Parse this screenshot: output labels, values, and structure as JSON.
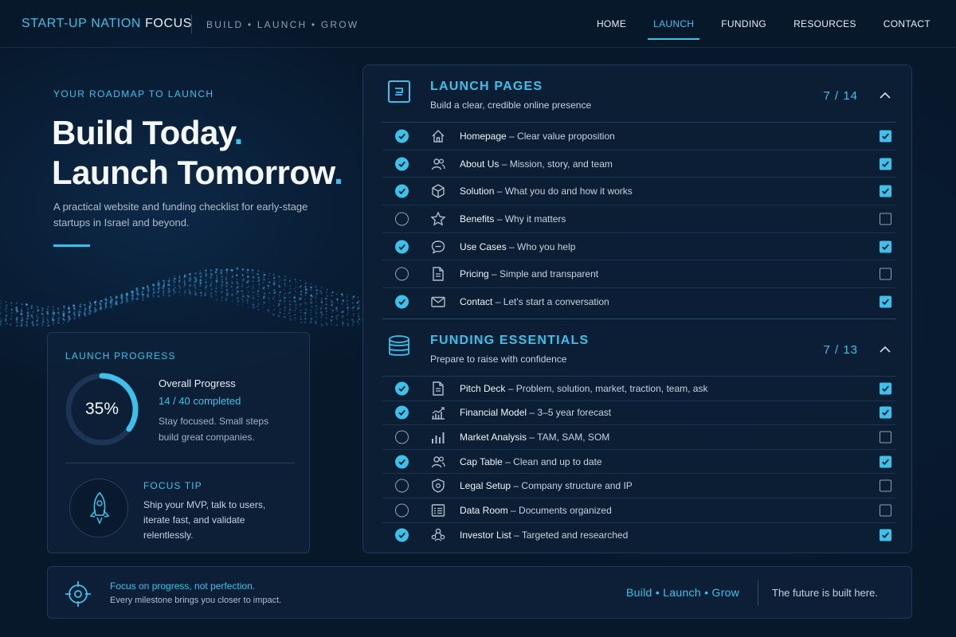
{
  "header": {
    "brand_accent": "START-UP NATION",
    "brand_focus": "FOCUS",
    "tagline": "BUILD • LAUNCH • GROW",
    "nav": [
      {
        "label": "HOME",
        "active": false
      },
      {
        "label": "LAUNCH",
        "active": true
      },
      {
        "label": "FUNDING",
        "active": false
      },
      {
        "label": "RESOURCES",
        "active": false
      },
      {
        "label": "CONTACT",
        "active": false
      }
    ]
  },
  "hero": {
    "eyebrow": "YOUR ROADMAP TO LAUNCH",
    "title_line1": "Build Today",
    "title_line2": "Launch Tomorrow",
    "title_dot": ".",
    "description": "A practical website and funding checklist for early-stage startups in Israel and beyond."
  },
  "progress_card": {
    "label": "LAUNCH PROGRESS",
    "percent_text": "35%",
    "percent_value": 35,
    "title": "Overall Progress",
    "count": "14 / 40 completed",
    "description": "Stay focused. Small steps build great companies.",
    "tip_title": "FOCUS TIP",
    "tip_text": "Ship your MVP, talk to users, iterate fast, and validate relentlessly."
  },
  "sections": [
    {
      "title": "LAUNCH PAGES",
      "subtitle": "Build a clear, credible online presence",
      "count": "7 / 14",
      "icon": "browser-window-icon",
      "items": [
        {
          "name": "Homepage",
          "desc": " – Clear value proposition",
          "done": true,
          "icon": "home"
        },
        {
          "name": "About Us",
          "desc": " – Mission, story, and team",
          "done": true,
          "icon": "users"
        },
        {
          "name": "Solution",
          "desc": " – What you do and how it works",
          "done": true,
          "icon": "cube"
        },
        {
          "name": "Benefits",
          "desc": " – Why it matters",
          "done": false,
          "icon": "star"
        },
        {
          "name": "Use Cases",
          "desc": " – Who you help",
          "done": true,
          "icon": "chat"
        },
        {
          "name": "Pricing",
          "desc": " – Simple and transparent",
          "done": false,
          "icon": "document"
        },
        {
          "name": "Contact",
          "desc": " – Let's start a conversation",
          "done": true,
          "icon": "mail"
        }
      ]
    },
    {
      "title": "FUNDING ESSENTIALS",
      "subtitle": "Prepare to raise with confidence",
      "count": "7 / 13",
      "icon": "coin-stack-icon",
      "items": [
        {
          "name": "Pitch Deck",
          "desc": " – Problem, solution, market, traction, team, ask",
          "done": true,
          "icon": "document"
        },
        {
          "name": "Financial Model",
          "desc": " – 3–5 year forecast",
          "done": true,
          "icon": "trend"
        },
        {
          "name": "Market Analysis",
          "desc": " – TAM, SAM, SOM",
          "done": false,
          "icon": "bars"
        },
        {
          "name": "Cap Table",
          "desc": " – Clean and up to date",
          "done": true,
          "icon": "users"
        },
        {
          "name": "Legal Setup",
          "desc": " – Company structure and IP",
          "done": false,
          "icon": "shield"
        },
        {
          "name": "Data Room",
          "desc": " – Documents organized",
          "done": false,
          "icon": "list"
        },
        {
          "name": "Investor List",
          "desc": " – Targeted and researched",
          "done": true,
          "icon": "network"
        }
      ]
    }
  ],
  "footer": {
    "title": "Focus on progress, not perfection.",
    "subtitle": "Every milestone brings you closer to impact.",
    "motto": "Build • Launch • Grow",
    "future": "The future is built here."
  },
  "colors": {
    "accent": "#3cc1ea",
    "background": "#07182b",
    "panel": "#0c1f35"
  }
}
